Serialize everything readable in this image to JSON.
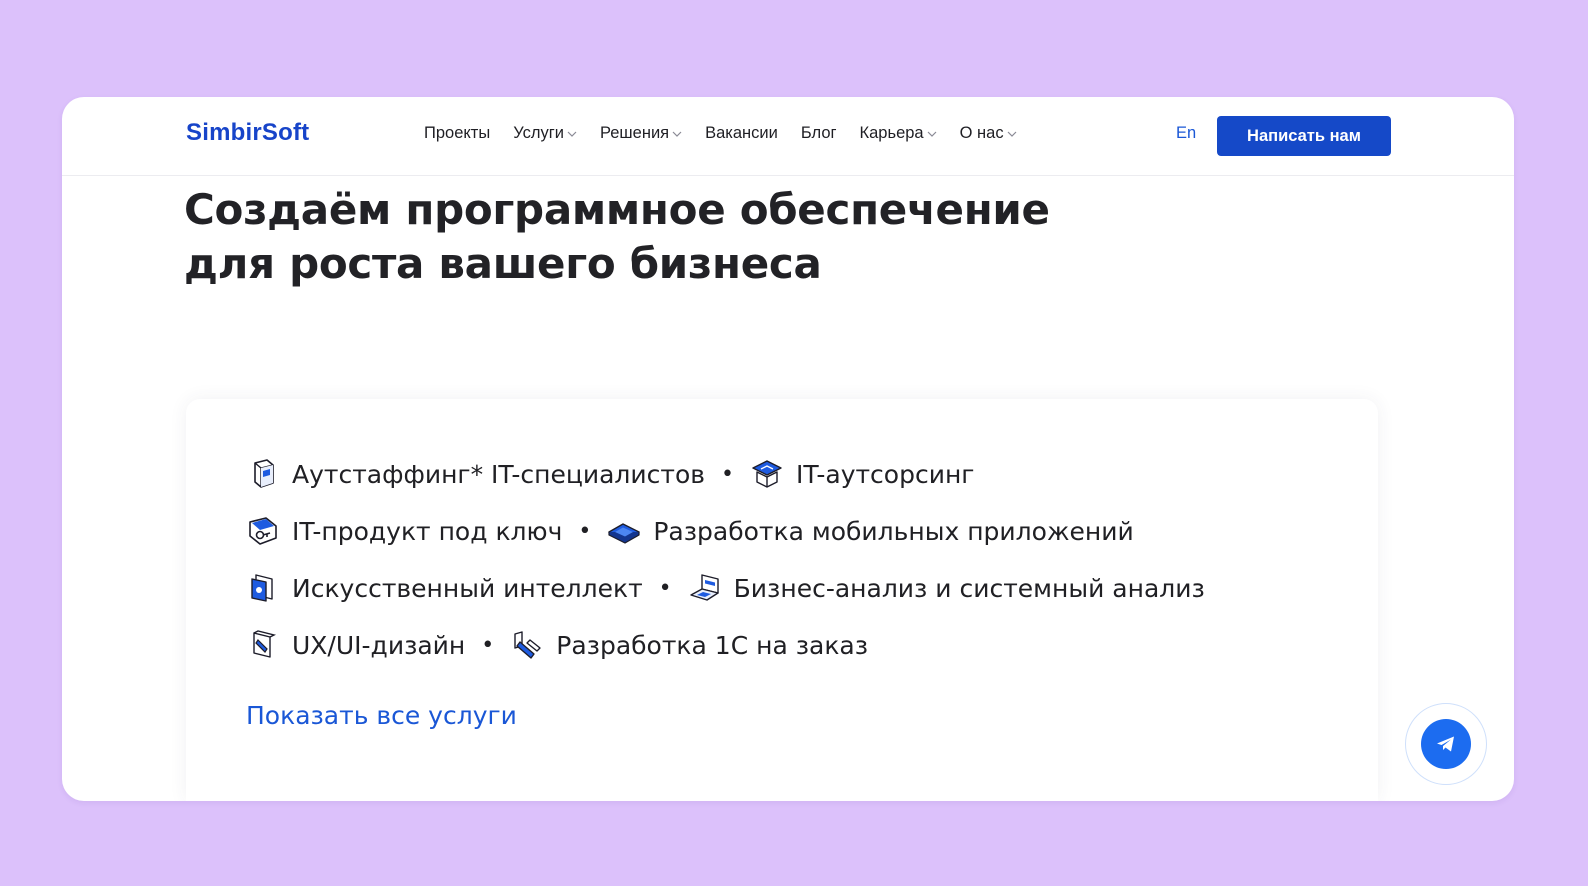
{
  "header": {
    "logo": "SimbirSoft",
    "nav": [
      {
        "label": "Проекты",
        "dropdown": false
      },
      {
        "label": "Услуги",
        "dropdown": true
      },
      {
        "label": "Решения",
        "dropdown": true
      },
      {
        "label": "Вакансии",
        "dropdown": false
      },
      {
        "label": "Блог",
        "dropdown": false
      },
      {
        "label": "Карьера",
        "dropdown": true
      },
      {
        "label": "О нас",
        "dropdown": true
      }
    ],
    "lang": "En",
    "cta": "Написать нам"
  },
  "hero": {
    "title_line1": "Создаём программное обеспечение",
    "title_line2": "для роста вашего бизнеса"
  },
  "services": {
    "rows": [
      [
        {
          "label": "Аутстаффинг* IT-специалистов",
          "icon": "puzzle-cube-icon"
        },
        {
          "label": "IT-аутсорсинг",
          "icon": "box-stack-icon"
        }
      ],
      [
        {
          "label": "IT-продукт под ключ",
          "icon": "key-device-icon"
        },
        {
          "label": "Разработка мобильных приложений",
          "icon": "smartphone-icon"
        }
      ],
      [
        {
          "label": "Искусственный интеллект",
          "icon": "ai-shield-icon"
        },
        {
          "label": "Бизнес-анализ и системный анализ",
          "icon": "laptop-chart-icon"
        }
      ],
      [
        {
          "label": "UX/UI-дизайн",
          "icon": "design-pen-icon"
        },
        {
          "label": "Разработка 1С на заказ",
          "icon": "code-tool-icon"
        }
      ]
    ],
    "show_all": "Показать все услуги"
  },
  "colors": {
    "background": "#dcc1fb",
    "brand": "#1549c8",
    "link": "#1a57d6",
    "telegram": "#1c6cf0"
  },
  "floating": {
    "icon": "telegram-icon"
  }
}
